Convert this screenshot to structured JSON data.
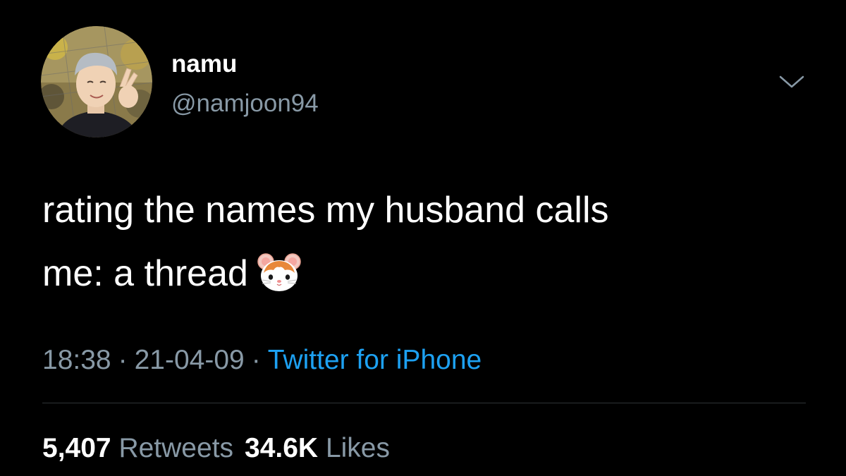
{
  "user": {
    "display_name": "namu",
    "handle": "@namjoon94"
  },
  "tweet": {
    "text_line_1": "rating the names my husband calls",
    "text_line_2": "me: a thread",
    "emoji": "hamster-face",
    "time": "18:38",
    "date": "21-04-09",
    "separator": "·",
    "source": "Twitter for iPhone"
  },
  "stats": {
    "retweets_count": "5,407",
    "retweets_label": "Retweets",
    "likes_count": "34.6K",
    "likes_label": "Likes"
  },
  "colors": {
    "background": "#000000",
    "text": "#ffffff",
    "secondary": "#8899a6",
    "link": "#1da1f2",
    "divider": "#2f3336"
  },
  "icons": {
    "menu": "chevron-down-icon"
  }
}
